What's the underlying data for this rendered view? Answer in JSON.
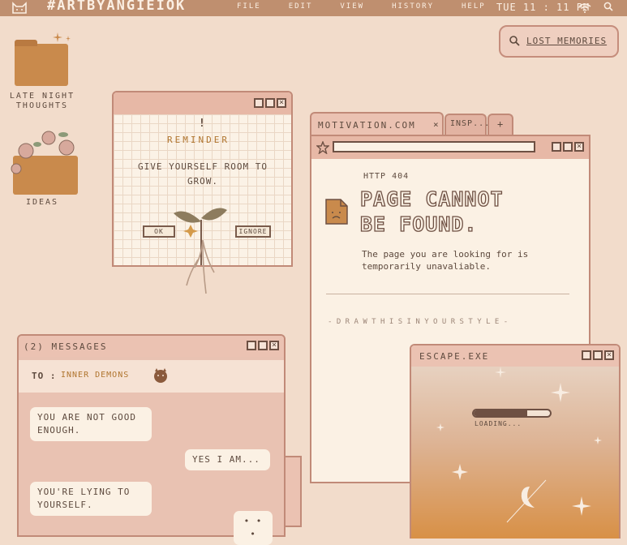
{
  "topbar": {
    "title": "#ARTBYANGIEIOK",
    "menu": [
      "FILE",
      "EDIT",
      "VIEW",
      "HISTORY",
      "HELP"
    ],
    "clock": "TUE 11 : 11 PM"
  },
  "search": {
    "text": "LOST MEMORIES"
  },
  "desktop": {
    "folder1_label": "LATE NIGHT THOUGHTS",
    "folder2_label": "IDEAS"
  },
  "reminder": {
    "mark": "!",
    "title": "REMINDER",
    "body": "GIVE YOURSELF ROOM TO GROW.",
    "ok_label": "OK",
    "ignore_label": "IGNORE"
  },
  "browser": {
    "tab1": "MOTIVATION.COM",
    "tab1_close": "×",
    "tab2": "INSP...",
    "tab_add": "+",
    "error_code": "HTTP 404",
    "heading_line1": "PAGE CANNOT",
    "heading_line2": "BE FOUND.",
    "message": "The page you are looking for is temporarily unavaliable.",
    "footer": "- D R A W  T H I S  I N  Y O U R  S T Y L E -"
  },
  "messages": {
    "title": "(2) MESSAGES",
    "to_label": "TO :",
    "to_value": "INNER DEMONS",
    "bubbles": [
      {
        "from": "left",
        "text": "YOU ARE NOT GOOD ENOUGH."
      },
      {
        "from": "right",
        "text": "YES I AM..."
      },
      {
        "from": "left",
        "text": "YOU'RE LYING TO YOURSELF."
      },
      {
        "from": "right",
        "text": "• • •"
      }
    ]
  },
  "escape": {
    "title": "ESCAPE.EXE",
    "loading_label": "LOADING...",
    "loading_progress": 0.7
  },
  "colors": {
    "desktop_bg": "#f2dccb",
    "topbar": "#bf8f6f",
    "window_bar": "#e7b8a6",
    "folder": "#c98a4c",
    "ink": "#5e4a3e"
  }
}
